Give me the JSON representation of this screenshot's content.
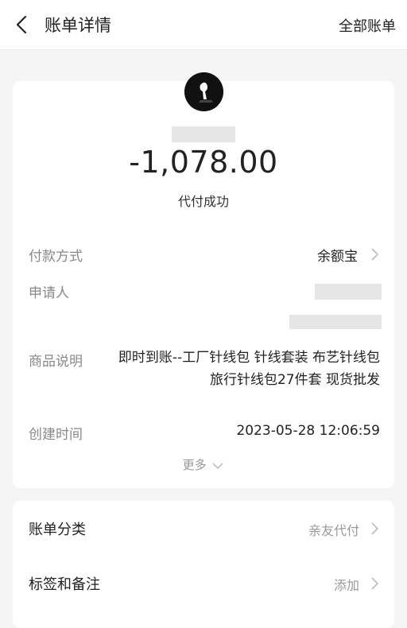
{
  "header": {
    "title": "账单详情",
    "right_link": "全部账单"
  },
  "summary": {
    "amount": "-1,078.00",
    "status": "代付成功"
  },
  "details": {
    "payment_method_label": "付款方式",
    "payment_method_value": "余额宝",
    "applicant_label": "申请人",
    "product_label": "商品说明",
    "product_value": "即时到账--工厂针线包 针线套装 布艺针线包 旅行针线包27件套 现货批发",
    "created_label": "创建时间",
    "created_value": "2023-05-28 12:06:59",
    "more_label": "更多"
  },
  "options": {
    "category_label": "账单分类",
    "category_value": "亲友代付",
    "tags_label": "标签和备注",
    "tags_value": "添加"
  },
  "colors": {
    "background": "#f5f5f5",
    "card": "#ffffff",
    "muted_text": "#888888",
    "masked_block": "#e6e6e6"
  }
}
